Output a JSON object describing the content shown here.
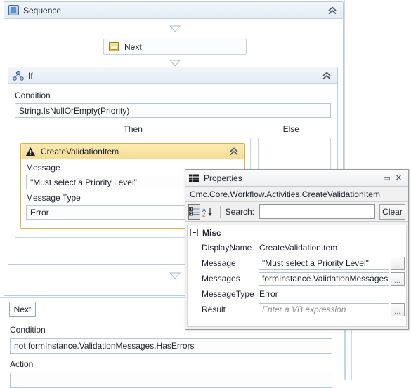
{
  "designer": {
    "sequence": {
      "title": "Sequence",
      "icon": "sequence-icon",
      "collapse_icon": "chevron-double-up-icon"
    },
    "next_activity": {
      "label": "Next",
      "icon": "activity-folder-icon"
    },
    "if_activity": {
      "title": "If",
      "icon": "if-branch-icon",
      "collapse_icon": "chevron-double-up-icon",
      "condition_label": "Condition",
      "condition_value": "String.IsNullOrEmpty(Priority)",
      "then_label": "Then",
      "else_label": "Else"
    },
    "create_validation_item": {
      "title": "CreateValidationItem",
      "icon": "warning-triangle-icon",
      "collapse_icon": "chevron-double-up-icon",
      "message_label": "Message",
      "message_value": "\"Must select a Priority Level\"",
      "message_type_label": "Message Type",
      "message_type_value": "Error"
    },
    "lower_panel": {
      "next_button": "Next",
      "condition_label": "Condition",
      "condition_value": "not formInstance.ValidationMessages.HasErrors",
      "action_label": "Action",
      "action_value": ""
    }
  },
  "properties_window": {
    "title": "Properties",
    "icon": "properties-grid-icon",
    "maximize_label": "▭",
    "close_label": "✕",
    "subtitle": "Cmc.Core.Workflow.Activities.CreateValidationItem",
    "toolbar": {
      "categorized_icon": "categorized-view-icon",
      "alphabetical_icon": "sort-alphabetical-icon",
      "search_label": "Search:",
      "search_value": "",
      "search_placeholder": "",
      "clear_label": "Clear"
    },
    "grid": {
      "group_label": "Misc",
      "group_expander_icon": "collapse-box-icon",
      "ellipsis_label": "...",
      "rows": [
        {
          "name": "DisplayName",
          "value": "CreateValidationItem",
          "editor": "plain",
          "has_ellipsis": false,
          "placeholder": false
        },
        {
          "name": "Message",
          "value": "\"Must select a Priority Level\"",
          "editor": "expression",
          "has_ellipsis": true,
          "placeholder": false
        },
        {
          "name": "Messages",
          "value": "formInstance.ValidationMessages",
          "editor": "expression",
          "has_ellipsis": true,
          "placeholder": false
        },
        {
          "name": "MessageType",
          "value": "Error",
          "editor": "plain",
          "has_ellipsis": false,
          "placeholder": false
        },
        {
          "name": "Result",
          "value": "Enter a VB expression",
          "editor": "expression",
          "has_ellipsis": true,
          "placeholder": true
        }
      ]
    }
  },
  "colors": {
    "activity_header": "#e4ecf4",
    "warning_header": "#f7dd95",
    "warning_border": "#d9b44a",
    "window_chrome": "#f0f0f0",
    "border": "#bfcad8"
  }
}
